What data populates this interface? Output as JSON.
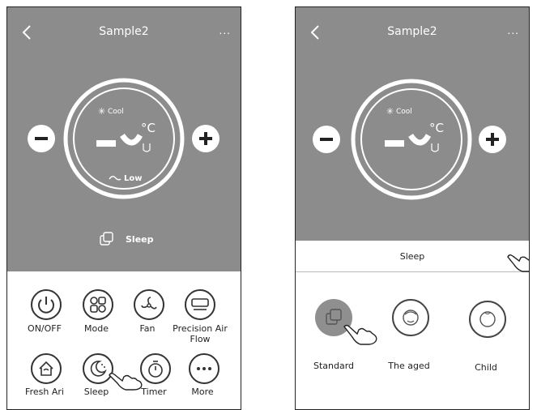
{
  "left_screen": {
    "title": "Sample2",
    "menu": "...",
    "mode_label": "Cool",
    "temperature_unit": "°C",
    "fan_label": "Low",
    "status_label": "Sleep",
    "buttons": [
      {
        "label": "ON/OFF",
        "icon": "power-icon"
      },
      {
        "label": "Mode",
        "icon": "mode-icon"
      },
      {
        "label": "Fan",
        "icon": "fan-icon"
      },
      {
        "label": "Precision Air Flow",
        "icon": "airflow-icon"
      },
      {
        "label": "Fresh Ari",
        "icon": "fresh-air-icon"
      },
      {
        "label": "Sleep",
        "icon": "sleep-icon"
      },
      {
        "label": "Timer",
        "icon": "timer-icon"
      },
      {
        "label": "More",
        "icon": "more-icon"
      }
    ]
  },
  "right_screen": {
    "title": "Sample2",
    "menu": "...",
    "mode_label": "Cool",
    "temperature_unit": "°C",
    "sheet": {
      "title": "Sleep",
      "close": "x",
      "options": [
        {
          "label": "Standard",
          "icon": "standard-sleep-icon",
          "selected": true
        },
        {
          "label": "The aged",
          "icon": "elderly-face-icon",
          "selected": false
        },
        {
          "label": "Child",
          "icon": "child-face-icon",
          "selected": false
        }
      ]
    }
  },
  "colors": {
    "header_gray": "#8c8c8c",
    "selected_option": "#8f8f8f"
  }
}
